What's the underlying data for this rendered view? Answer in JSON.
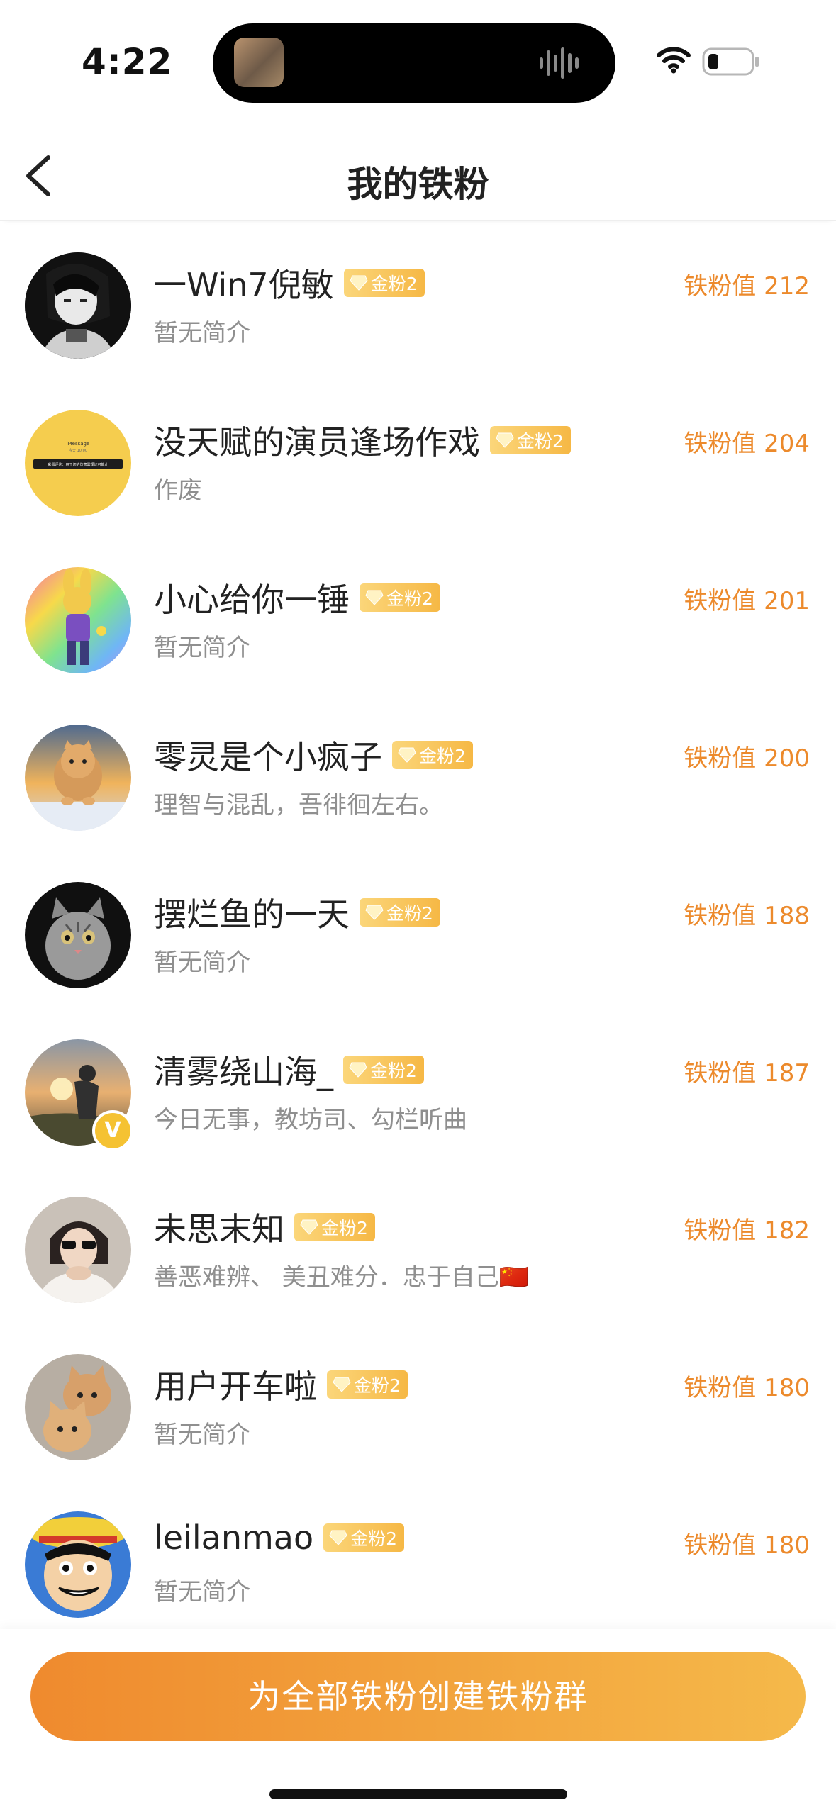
{
  "status_bar": {
    "time": "4:22"
  },
  "header": {
    "title": "我的铁粉"
  },
  "fans": [
    {
      "name": "一Win7倪敏",
      "badge": "金粉2",
      "bio": "暂无简介",
      "score": "铁粉值 212",
      "avatar": "anime-girl-avatar"
    },
    {
      "name": "没天赋的演员逢场作戏",
      "badge": "金粉2",
      "bio": "作废",
      "score": "铁粉值 204",
      "avatar": "imessage-screenshot-avatar"
    },
    {
      "name": "小心给你一锤",
      "badge": "金粉2",
      "bio": "暂无简介",
      "score": "铁粉值 201",
      "avatar": "cartoon-rabbit-avatar"
    },
    {
      "name": "零灵是个小疯子",
      "badge": "金粉2",
      "bio": "理智与混乱，吾徘徊左右。",
      "score": "铁粉值 200",
      "avatar": "jumping-cat-avatar"
    },
    {
      "name": "摆烂鱼的一天",
      "badge": "金粉2",
      "bio": "暂无简介",
      "score": "铁粉值 188",
      "avatar": "tabby-cat-avatar"
    },
    {
      "name": "清雾绕山海_",
      "badge": "金粉2",
      "bio": "今日无事，教坊司、勾栏听曲",
      "score": "铁粉值 187",
      "avatar": "sunset-person-avatar",
      "verified": "V"
    },
    {
      "name": "未思末知",
      "badge": "金粉2",
      "bio": "善恶难辨、 美丑难分．忠于自己🇨🇳",
      "score": "铁粉值 182",
      "avatar": "sunglasses-person-avatar"
    },
    {
      "name": "用户开车啦",
      "badge": "金粉2",
      "bio": "暂无简介",
      "score": "铁粉值 180",
      "avatar": "two-cats-avatar"
    },
    {
      "name": "leilanmao",
      "badge": "金粉2",
      "bio": "暂无简介",
      "score": "铁粉值 180",
      "avatar": "luffy-avatar"
    }
  ],
  "avatar_thumb": {
    "title": "iMessage",
    "line1": "今天 10:00",
    "line2": "彩蛋评论：用于切的伤害需理论可能止"
  },
  "footer": {
    "button_label": "为全部铁粉创建铁粉群"
  },
  "colors": {
    "accent": "#ec8a2c",
    "button_start": "#ef8a2e",
    "button_end": "#f5b94a",
    "badge": "#f6b845"
  }
}
